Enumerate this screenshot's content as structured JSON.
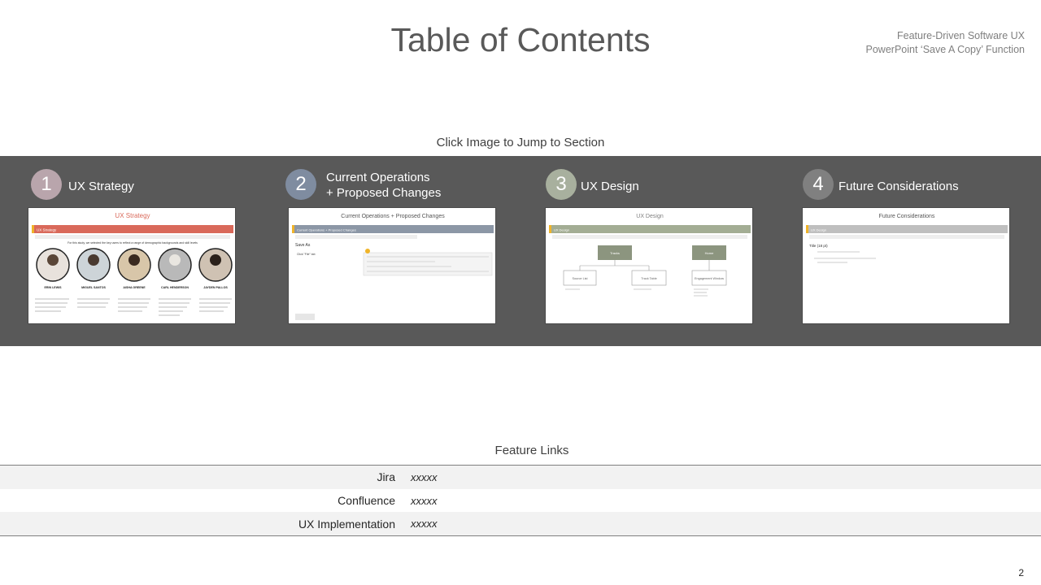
{
  "header": {
    "title": "Table of Contents",
    "meta_line1": "Feature-Driven Software UX",
    "meta_line2": "PowerPoint ‘Save A Copy’ Function"
  },
  "instruction": "Click Image to Jump to Section",
  "sections": [
    {
      "number": "1",
      "label": "UX Strategy",
      "color": "#b9a5ac",
      "thumb": {
        "title": "UX Strategy",
        "tab": "UX Strategy",
        "accent": "#d9695a",
        "intro": "For this study, we selected the key users to reflect a range of demographic backgrounds and skill levels",
        "people": [
          "ERIN LEWIS",
          "MIGUEL SANTOS",
          "AISHA GREENE",
          "CARL HENDERSON",
          "JAYDEN PALLOS"
        ]
      }
    },
    {
      "number": "2",
      "label": "Current Operations\n+ Proposed Changes",
      "color": "#7f8ca0",
      "thumb": {
        "title": "Current Operations + Proposed Changes",
        "tab": "Current Operations + Proposed Changes",
        "accent": "#8c97a6",
        "heading": "Save As",
        "bullet": "Click \"File\" tab"
      }
    },
    {
      "number": "3",
      "label": "UX Design",
      "color": "#a8b09e",
      "thumb": {
        "title": "UX Design",
        "tab": "UX Design",
        "accent": "#a3ad94",
        "node_a": "Tracks",
        "node_b": "Home",
        "child_a": "Source List",
        "child_b": "Track Table",
        "child_c": "Engagement Window"
      }
    },
    {
      "number": "4",
      "label": "Future Considerations",
      "color": "#808080",
      "thumb": {
        "title": "Future Considerations",
        "tab": "UX Design",
        "accent": "#bfbfbf",
        "heading": "Title (18 pt)"
      }
    }
  ],
  "feature_links": {
    "title": "Feature Links",
    "rows": [
      {
        "label": "Jira",
        "value": "xxxxx"
      },
      {
        "label": "Confluence",
        "value": "xxxxx"
      },
      {
        "label": "UX Implementation",
        "value": "xxxxx"
      }
    ]
  },
  "page_number": "2"
}
